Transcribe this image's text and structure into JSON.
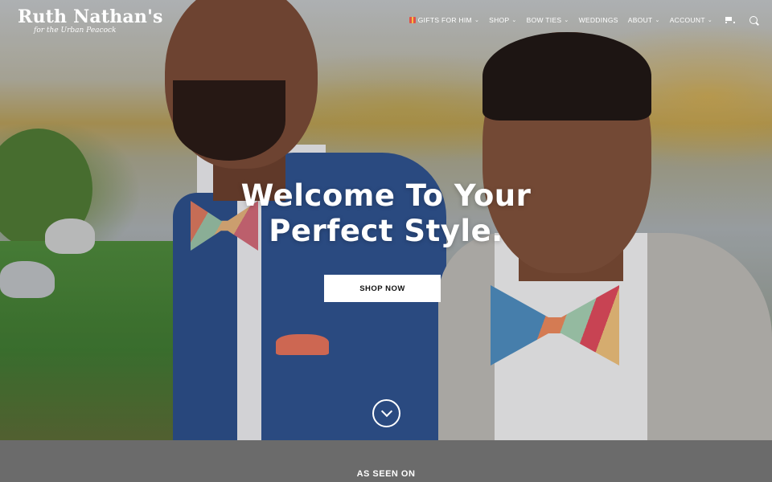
{
  "brand": {
    "name": "Ruth Nathan's",
    "tagline": "for the Urban Peacock"
  },
  "nav": {
    "items": [
      {
        "label": "GIFTS FOR HIM",
        "icon": "gift-icon",
        "has_dropdown": true
      },
      {
        "label": "SHOP",
        "has_dropdown": true
      },
      {
        "label": "BOW TIES",
        "has_dropdown": true
      },
      {
        "label": "WEDDINGS",
        "has_dropdown": false
      },
      {
        "label": "ABOUT",
        "has_dropdown": true
      },
      {
        "label": "ACCOUNT",
        "has_dropdown": true
      }
    ],
    "chevron": "⌄",
    "cart_icon": "cart-icon",
    "search_icon": "search-icon"
  },
  "hero": {
    "headline_line1": "Welcome To Your",
    "headline_line2": "Perfect Style.",
    "cta_label": "SHOP NOW",
    "scroll_icon": "chevron-down-circle-icon"
  },
  "seen_on": {
    "title": "AS SEEN ON"
  },
  "colors": {
    "text": "#ffffff",
    "button_bg": "#ffffff",
    "button_text": "#111111",
    "section_bg": "#6b6b6b",
    "gift_red": "#e0534a"
  }
}
